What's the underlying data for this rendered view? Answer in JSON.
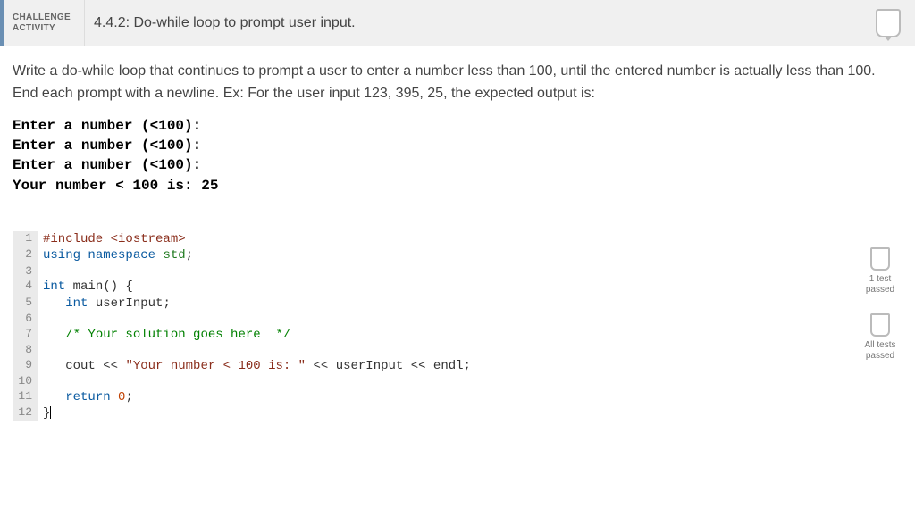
{
  "header": {
    "label_line1": "CHALLENGE",
    "label_line2": "ACTIVITY",
    "title": "4.4.2: Do-while loop to prompt user input."
  },
  "instructions": "Write a do-while loop that continues to prompt a user to enter a number less than 100, until the entered number is actually less than 100. End each prompt with a newline. Ex: For the user input 123, 395, 25, the expected output is:",
  "expected_output": "Enter a number (<100):\nEnter a number (<100):\nEnter a number (<100):\nYour number < 100 is: 25",
  "code_lines": [
    {
      "n": 1,
      "tokens": [
        [
          "tk-preproc",
          "#include "
        ],
        [
          "tk-string",
          "<iostream>"
        ]
      ]
    },
    {
      "n": 2,
      "tokens": [
        [
          "tk-keyword",
          "using "
        ],
        [
          "tk-keyword",
          "namespace "
        ],
        [
          "tk-ns",
          "std"
        ],
        [
          "tk-punc",
          ";"
        ]
      ]
    },
    {
      "n": 3,
      "tokens": []
    },
    {
      "n": 4,
      "tokens": [
        [
          "tk-type",
          "int "
        ],
        [
          "tk-ident",
          "main"
        ],
        [
          "tk-punc",
          "() {"
        ]
      ],
      "cursor": true
    },
    {
      "n": 5,
      "tokens": [
        [
          "",
          "   "
        ],
        [
          "tk-type",
          "int "
        ],
        [
          "tk-ident",
          "userInput"
        ],
        [
          "tk-punc",
          ";"
        ]
      ]
    },
    {
      "n": 6,
      "tokens": []
    },
    {
      "n": 7,
      "tokens": [
        [
          "",
          "   "
        ],
        [
          "tk-comment",
          "/* Your solution goes here  */"
        ]
      ]
    },
    {
      "n": 8,
      "tokens": []
    },
    {
      "n": 9,
      "tokens": [
        [
          "",
          "   "
        ],
        [
          "tk-ident",
          "cout"
        ],
        [
          "tk-punc",
          " << "
        ],
        [
          "tk-string",
          "\"Your number < 100 is: \""
        ],
        [
          "tk-punc",
          " << "
        ],
        [
          "tk-ident",
          "userInput"
        ],
        [
          "tk-punc",
          " << "
        ],
        [
          "tk-ident",
          "endl"
        ],
        [
          "tk-punc",
          ";"
        ]
      ]
    },
    {
      "n": 10,
      "tokens": []
    },
    {
      "n": 11,
      "tokens": [
        [
          "",
          "   "
        ],
        [
          "tk-keyword",
          "return "
        ],
        [
          "tk-number",
          "0"
        ],
        [
          "tk-punc",
          ";"
        ]
      ]
    },
    {
      "n": 12,
      "tokens": [
        [
          "tk-punc",
          "}"
        ]
      ],
      "cursor_after": true
    }
  ],
  "tests": {
    "one": {
      "line1": "1 test",
      "line2": "passed"
    },
    "all": {
      "line1": "All tests",
      "line2": "passed"
    }
  }
}
